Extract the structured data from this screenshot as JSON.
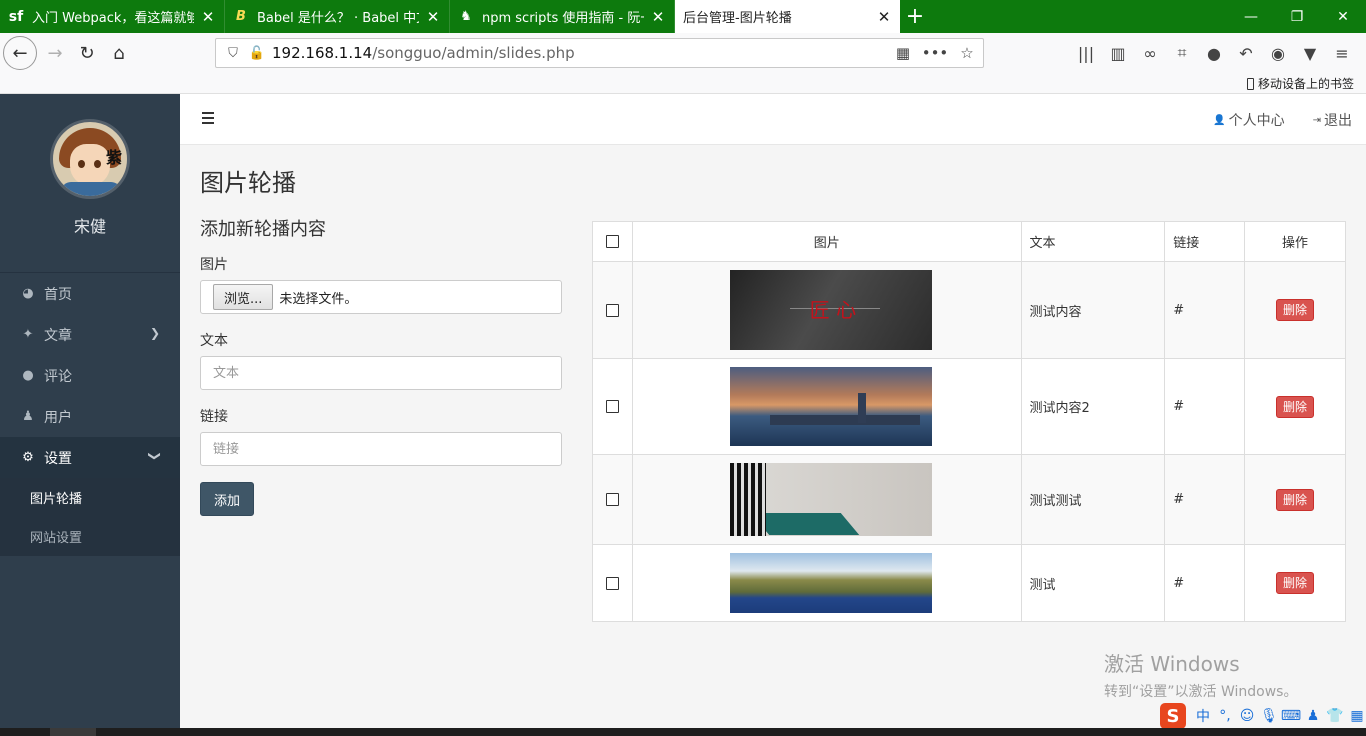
{
  "browser": {
    "tabs": [
      {
        "favicon": "sf",
        "title": "入门 Webpack，看这篇就够了",
        "active": false
      },
      {
        "favicon": "B",
        "title": "Babel 是什么？ · Babel 中文网",
        "active": false
      },
      {
        "favicon": "♞",
        "title": "npm scripts 使用指南 - 阮一峰",
        "active": false
      },
      {
        "favicon": "",
        "title": "后台管理-图片轮播",
        "active": true
      }
    ],
    "new_tab": "+",
    "url_host": "192.168.1.14",
    "url_path": "/songguo/admin/slides.php",
    "mobile_bookmarks": "移动设备上的书签"
  },
  "sidebar": {
    "user_name": "宋健",
    "menu": [
      {
        "icon": "dashboard-icon",
        "label": "首页",
        "has_arrow": false
      },
      {
        "icon": "thumbtack-icon",
        "label": "文章",
        "has_arrow": true
      },
      {
        "icon": "comments-icon",
        "label": "评论",
        "has_arrow": false
      },
      {
        "icon": "users-icon",
        "label": "用户",
        "has_arrow": false
      },
      {
        "icon": "cogs-icon",
        "label": "设置",
        "has_arrow": true,
        "open": true
      }
    ],
    "submenu": [
      {
        "label": "图片轮播",
        "active": true
      },
      {
        "label": "网站设置",
        "active": false
      }
    ]
  },
  "topbar": {
    "profile_link": "个人中心",
    "logout_link": "退出"
  },
  "page": {
    "title": "图片轮播",
    "form": {
      "heading": "添加新轮播内容",
      "image_label": "图片",
      "browse_button": "浏览...",
      "no_file_text": "未选择文件。",
      "text_label": "文本",
      "text_placeholder": "文本",
      "link_label": "链接",
      "link_placeholder": "链接",
      "submit_label": "添加"
    },
    "table": {
      "headers": {
        "image": "图片",
        "text": "文本",
        "link": "链接",
        "actions": "操作"
      },
      "rows": [
        {
          "text": "测试内容",
          "link": "#",
          "delete": "删除",
          "thumb_caption": "匠 心"
        },
        {
          "text": "测试内容2",
          "link": "#",
          "delete": "删除"
        },
        {
          "text": "测试测试",
          "link": "#",
          "delete": "删除"
        },
        {
          "text": "测试",
          "link": "#",
          "delete": "删除"
        }
      ]
    }
  },
  "watermark": {
    "line1": "激活 Windows",
    "line2": "转到“设置”以激活 Windows。"
  },
  "ime": {
    "logo": "S",
    "mode": "中"
  }
}
